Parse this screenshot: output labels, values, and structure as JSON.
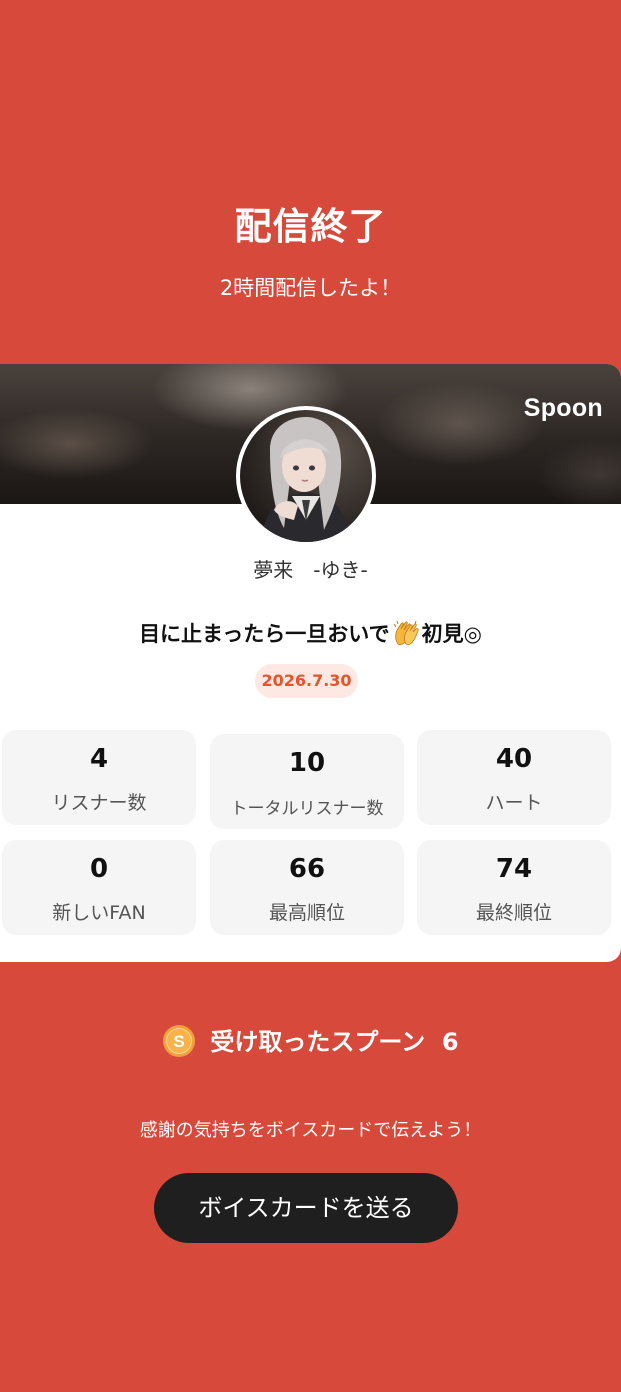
{
  "header": {
    "title": "配信終了",
    "subtitle": "2時間配信したよ！"
  },
  "profile": {
    "brand": "Spoon",
    "name": "夢来　-ゆき-",
    "broadcast_title_before": "目に止まったら一旦おいで",
    "broadcast_title_after": "初見◎",
    "date": "2026.7.30"
  },
  "stats": [
    {
      "value": "4",
      "label": "リスナー数"
    },
    {
      "value": "10",
      "label": "トータルリスナー数"
    },
    {
      "value": "40",
      "label": "ハート"
    },
    {
      "value": "0",
      "label": "新しいFAN"
    },
    {
      "value": "66",
      "label": "最高順位"
    },
    {
      "value": "74",
      "label": "最終順位"
    }
  ],
  "footer": {
    "spoons_label": "受け取ったスプーン",
    "spoons_count": "6",
    "thanks_text": "感謝の気持ちをボイスカードで伝えよう！",
    "voice_card_button": "ボイスカードを送る"
  },
  "colors": {
    "background": "#d74a3b",
    "card": "#ffffff",
    "date_badge_bg": "#fde8e3",
    "date_badge_text": "#e5552a",
    "button": "#1f1f1f"
  },
  "icons": [
    "clapping-hands-icon",
    "spoon-coin-icon"
  ]
}
